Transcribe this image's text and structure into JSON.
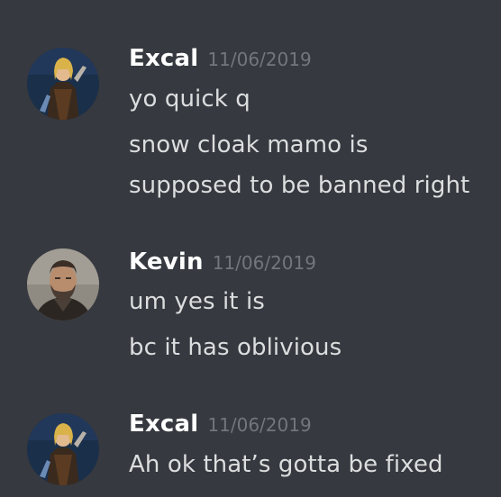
{
  "messages": [
    {
      "author": "Excal",
      "timestamp": "11/06/2019",
      "avatar": "excal-avatar",
      "lines": [
        "yo quick q",
        "snow cloak mamo is",
        "supposed to be banned right"
      ]
    },
    {
      "author": "Kevin",
      "timestamp": "11/06/2019",
      "avatar": "kevin-avatar",
      "lines": [
        "um yes it is",
        "bc it has oblivious"
      ]
    },
    {
      "author": "Excal",
      "timestamp": "11/06/2019",
      "avatar": "excal-avatar",
      "lines": [
        "Ah ok that’s gotta be fixed"
      ]
    }
  ]
}
